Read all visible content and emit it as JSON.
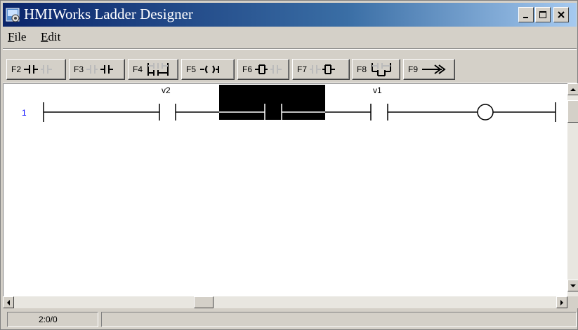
{
  "window": {
    "title": "HMIWorks Ladder Designer"
  },
  "menu": {
    "items": [
      {
        "label": "File",
        "key": "F"
      },
      {
        "label": "Edit",
        "key": "E"
      }
    ]
  },
  "toolbar": {
    "buttons": [
      {
        "key": "F2",
        "icon": "normally-open-contact-icon"
      },
      {
        "key": "F3",
        "icon": "normally-closed-contact-icon"
      },
      {
        "key": "F4",
        "icon": "parallel-branch-icon"
      },
      {
        "key": "F5",
        "icon": "output-coil-icon"
      },
      {
        "key": "F6",
        "icon": "insert-contact-left-icon"
      },
      {
        "key": "F7",
        "icon": "insert-contact-right-icon"
      },
      {
        "key": "F8",
        "icon": "branch-down-icon"
      },
      {
        "key": "F9",
        "icon": "connect-line-icon"
      }
    ]
  },
  "ladder": {
    "rungs": [
      {
        "number": "1",
        "contacts": [
          {
            "name": "v2"
          },
          {
            "name": "v1"
          }
        ]
      }
    ]
  },
  "status": {
    "position": "2:0/0"
  },
  "colors": {
    "title_start": "#0a246a",
    "title_end": "#a6caf0",
    "rung_number": "#0000ff",
    "selection": "#000000"
  }
}
